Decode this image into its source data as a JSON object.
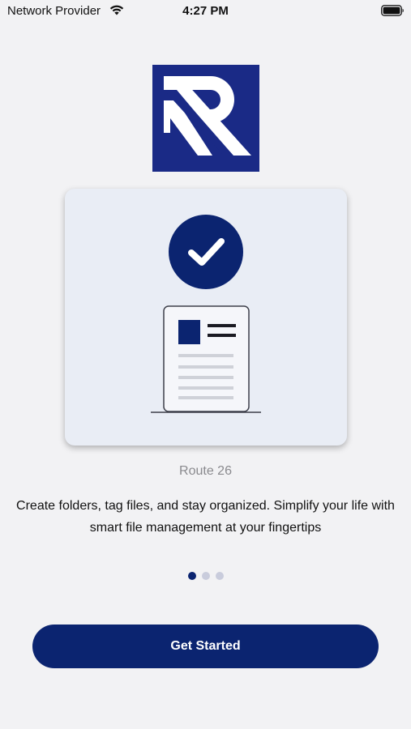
{
  "status_bar": {
    "carrier": "Network Provider",
    "time": "4:27 PM",
    "wifi_icon": "wifi-icon",
    "battery_icon": "battery-full-icon"
  },
  "logo": {
    "icon": "r-monogram-logo",
    "background": "#1a2a86"
  },
  "illustration": {
    "check_icon": "checkmark-circle-icon",
    "document_icon": "document-icon",
    "accent": "#0b2470"
  },
  "onboarding": {
    "brand_name": "Route 26",
    "description": "Create folders, tag files, and stay organized. Simplify your life with smart file management at your fingertips",
    "page_count": 3,
    "current_page": 1
  },
  "cta": {
    "label": "Get Started",
    "color": "#0b2470"
  }
}
